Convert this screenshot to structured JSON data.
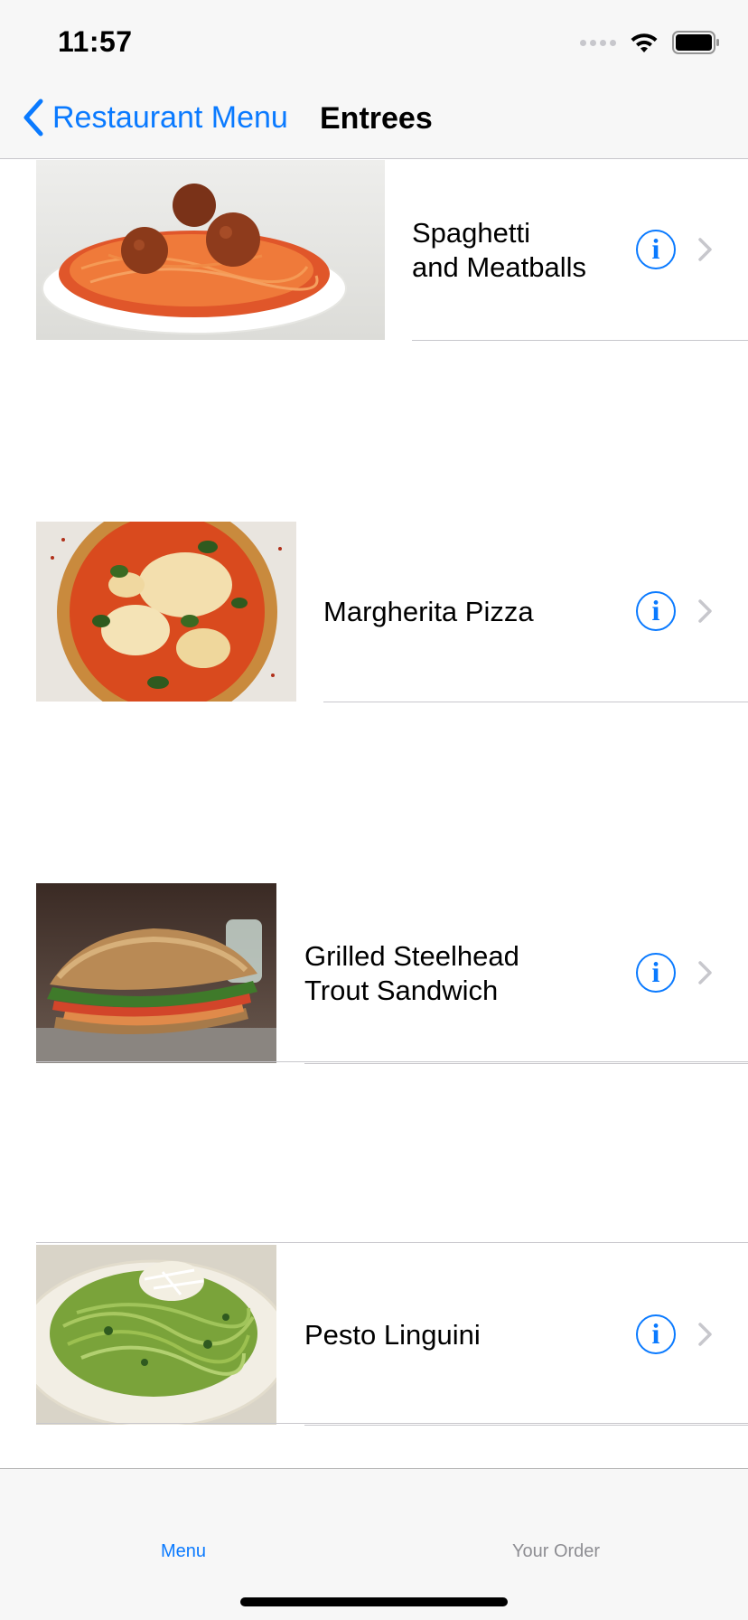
{
  "status_bar": {
    "time": "11:57"
  },
  "nav": {
    "back_label": "Restaurant Menu",
    "title": "Entrees"
  },
  "items": [
    {
      "name_line1": "Spaghetti",
      "name_line2": "and Meatballs",
      "image": "spaghetti-meatballs-photo"
    },
    {
      "name_line1": "Margherita Pizza",
      "name_line2": "",
      "image": "margherita-pizza-photo"
    },
    {
      "name_line1": "Grilled Steelhead",
      "name_line2": "Trout Sandwich",
      "image": "trout-sandwich-photo"
    },
    {
      "name_line1": "Pesto Linguini",
      "name_line2": "",
      "image": "pesto-linguini-photo"
    }
  ],
  "info_glyph": "i",
  "tabs": [
    {
      "label": "Menu",
      "selected": true
    },
    {
      "label": "Your Order",
      "selected": false
    }
  ],
  "colors": {
    "accent": "#0a7aff",
    "inactive_tab": "#8e8e93",
    "separator": "#c8c7cc"
  }
}
